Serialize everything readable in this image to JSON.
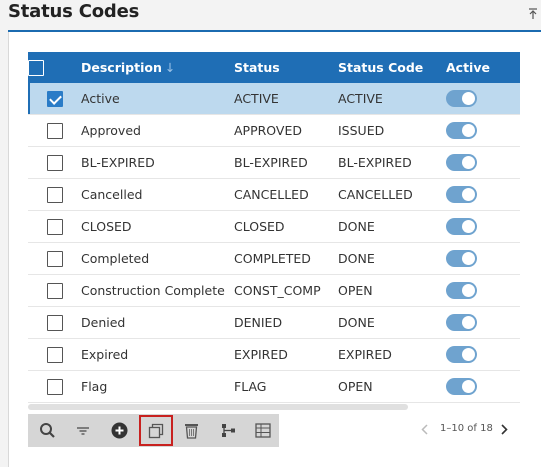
{
  "panel": {
    "title": "Status Codes"
  },
  "columns": {
    "description": "Description",
    "sort_indicator": "↓",
    "status": "Status",
    "status_code": "Status Code",
    "active": "Active"
  },
  "rows": [
    {
      "description": "Active",
      "status": "ACTIVE",
      "status_code": "ACTIVE",
      "active": true,
      "selected": true
    },
    {
      "description": "Approved",
      "status": "APPROVED",
      "status_code": "ISSUED",
      "active": true,
      "selected": false
    },
    {
      "description": "BL-EXPIRED",
      "status": "BL-EXPIRED",
      "status_code": "BL-EXPIRED",
      "active": true,
      "selected": false
    },
    {
      "description": "Cancelled",
      "status": "CANCELLED",
      "status_code": "CANCELLED",
      "active": true,
      "selected": false
    },
    {
      "description": "CLOSED",
      "status": "CLOSED",
      "status_code": "DONE",
      "active": true,
      "selected": false
    },
    {
      "description": "Completed",
      "status": "COMPLETED",
      "status_code": "DONE",
      "active": true,
      "selected": false
    },
    {
      "description": "Construction Complete",
      "status": "CONST_COMP",
      "status_code": "OPEN",
      "active": true,
      "selected": false
    },
    {
      "description": "Denied",
      "status": "DENIED",
      "status_code": "DONE",
      "active": true,
      "selected": false
    },
    {
      "description": "Expired",
      "status": "EXPIRED",
      "status_code": "EXPIRED",
      "active": true,
      "selected": false
    },
    {
      "description": "Flag",
      "status": "FLAG",
      "status_code": "OPEN",
      "active": true,
      "selected": false
    }
  ],
  "toolbar": {
    "icons": [
      "search-icon",
      "filter-icon",
      "add-icon",
      "copy-icon",
      "delete-icon",
      "hierarchy-icon",
      "columns-icon"
    ],
    "highlighted": "copy-icon"
  },
  "pager": {
    "text": "1–10 of 18"
  },
  "colors": {
    "header_bg": "#1f6eb5",
    "selected_row": "#bdd9ee",
    "toggle_on": "#6fa3cf",
    "highlight": "#c8211f"
  }
}
